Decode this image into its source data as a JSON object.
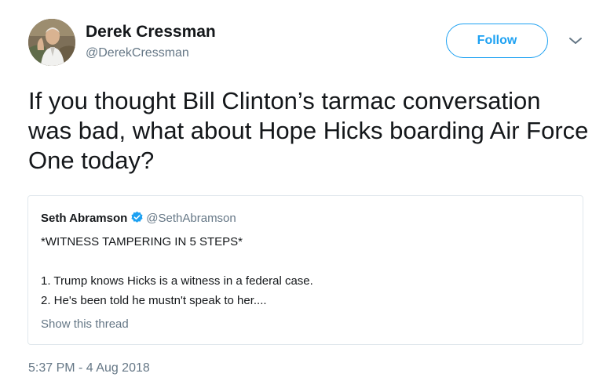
{
  "author": {
    "display_name": "Derek Cressman",
    "handle": "@DerekCressman"
  },
  "actions": {
    "follow_label": "Follow",
    "more_icon": "chevron-down-icon"
  },
  "tweet": {
    "text": "If you thought Bill Clinton’s tarmac conversation was bad, what about Hope Hicks boarding Air Force One today?",
    "timestamp": "5:37 PM - 4 Aug 2018"
  },
  "quoted_tweet": {
    "display_name": "Seth Abramson",
    "verified_icon": "verified-badge-icon",
    "handle": "@SethAbramson",
    "lines": [
      "*WITNESS TAMPERING IN 5 STEPS*",
      "1. Trump knows Hicks is a witness in a federal case.",
      "2. He's been told he mustn't speak to her...."
    ],
    "show_thread_label": "Show this thread"
  },
  "colors": {
    "accent": "#1da1f2",
    "text_primary": "#14171a",
    "text_secondary": "#657786",
    "border": "#e1e8ed"
  }
}
